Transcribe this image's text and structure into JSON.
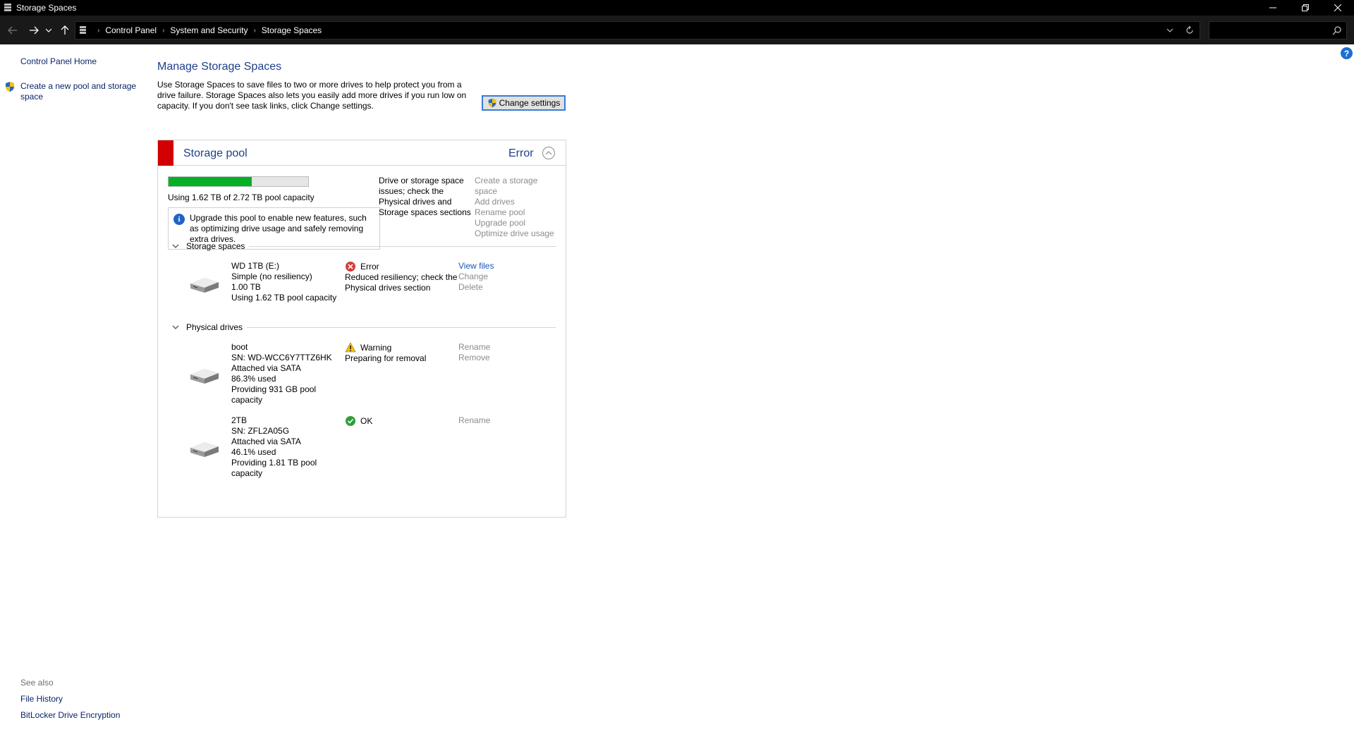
{
  "window": {
    "title": "Storage Spaces",
    "controls": [
      "minimize",
      "restore",
      "close"
    ]
  },
  "address": {
    "breadcrumbs": [
      "Control Panel",
      "System and Security",
      "Storage Spaces"
    ],
    "search_placeholder": ""
  },
  "nav": {
    "home": "Control Panel Home",
    "create": "Create a new pool and storage space",
    "see_also": "See also",
    "file_history": "File History",
    "bitlocker": "BitLocker Drive Encryption"
  },
  "main": {
    "heading": "Manage Storage Spaces",
    "intro": "Use Storage Spaces to save files to two or more drives to help protect you from a drive failure. Storage Spaces also lets you easily add more drives if you run low on capacity. If you don't see task links, click Change settings.",
    "change_settings": "Change settings"
  },
  "pool": {
    "name": "Storage pool",
    "status": "Error",
    "status_color": "#d20000",
    "capacity_used_fraction": 0.596,
    "capacity_text": "Using 1.62 TB of 2.72 TB pool capacity",
    "info": "Upgrade this pool to enable new features, such as optimizing drive usage and safely removing extra drives.",
    "warning": "Drive or storage space issues; check the Physical drives and Storage spaces sections",
    "tasks": [
      "Create a storage space",
      "Add drives",
      "Rename pool",
      "Upgrade pool",
      "Optimize drive usage"
    ]
  },
  "storage_spaces": {
    "label": "Storage spaces",
    "items": [
      {
        "lines": [
          "WD 1TB (E:)",
          "Simple (no resiliency)",
          "1.00 TB",
          "Using 1.62 TB pool capacity"
        ],
        "status": "Error",
        "status_icon": "error-icon",
        "status_detail": "Reduced resiliency; check the Physical drives section",
        "tasks": [
          "View files",
          "Change",
          "Delete"
        ]
      }
    ]
  },
  "physical_drives": {
    "label": "Physical drives",
    "items": [
      {
        "lines": [
          "boot",
          "SN: WD-WCC6Y7TTZ6HK",
          "Attached via SATA",
          "86.3% used",
          "Providing 931 GB pool capacity"
        ],
        "status": "Warning",
        "status_icon": "warning-icon",
        "status_detail": "Preparing for removal",
        "tasks": [
          "Rename",
          "Remove"
        ]
      },
      {
        "lines": [
          "2TB",
          "SN: ZFL2A05G",
          "Attached via SATA",
          "46.1% used",
          "Providing 1.81 TB pool capacity"
        ],
        "status": "OK",
        "status_icon": "ok-icon",
        "status_detail": "",
        "tasks": [
          "Rename"
        ]
      }
    ]
  }
}
